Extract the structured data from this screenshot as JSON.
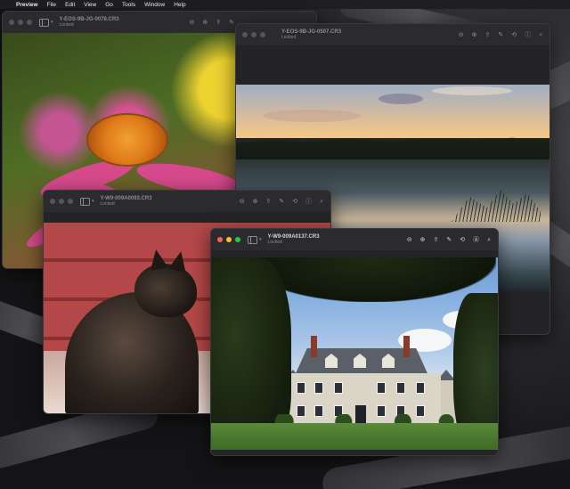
{
  "menubar": {
    "app": "Preview",
    "items": [
      "File",
      "Edit",
      "View",
      "Go",
      "Tools",
      "Window",
      "Help"
    ]
  },
  "windows": {
    "flower": {
      "title": "Y-EOS-9B-JG-0078.CR3",
      "subtitle": "Locked"
    },
    "lake": {
      "title": "Y-EOS-9B-JG-0507.CR3",
      "subtitle": "Locked"
    },
    "cat": {
      "title": "Y-W9-009A0093.CR3",
      "subtitle": "Locked"
    },
    "house": {
      "title": "Y-W9-009A0137.CR3",
      "subtitle": "Locked"
    }
  },
  "icons": {
    "apple": "",
    "zoom_out": "⊖",
    "zoom_in": "⊕",
    "share": "⇪",
    "markup": "✎",
    "rotate": "⟲",
    "info": "ⓘ",
    "annotate": "Ⓐ",
    "search": "⌕"
  }
}
